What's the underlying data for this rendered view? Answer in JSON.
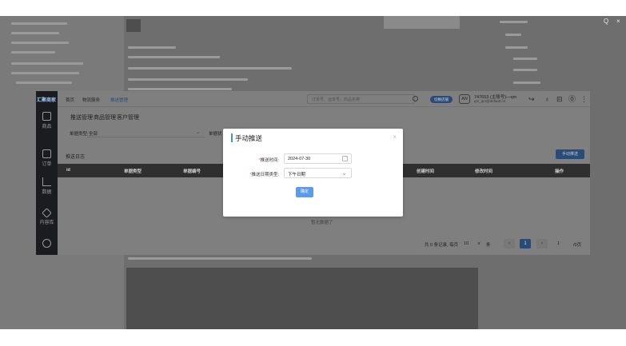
{
  "viewer": {
    "controls": [
      "Q",
      "×"
    ]
  },
  "app": {
    "logo": "汇聚商家",
    "sidebar": [
      {
        "label": "商品",
        "icon": "shopping-bag-icon"
      },
      {
        "label": "订单",
        "icon": "order-icon"
      },
      {
        "label": "数据",
        "icon": "chart-icon"
      },
      {
        "label": "内容库",
        "icon": "content-icon"
      },
      {
        "label": "",
        "icon": "gear-icon"
      }
    ],
    "breadcrumb": [
      "首页",
      "物流服务",
      "推送管理"
    ],
    "search_placeholder": "订单号、运单号、商品名称",
    "header_pill": "切换店铺",
    "avatar_text": "AW",
    "user_line1": "747653 (主账号)—qm",
    "user_line2": "qm_qm@default.cn",
    "tabs": [
      "推送管理",
      "商品管理",
      "客户管理"
    ],
    "filter_label": "单据类型:",
    "filter_value": "全部",
    "filter_label2": "单据状",
    "section_title": "推送日志",
    "push_button": "手动推送",
    "table_headers": [
      "id",
      "单据类型",
      "单据编号",
      "创建时间",
      "修改时间",
      "操作"
    ],
    "empty_text": "暂无数据了",
    "pagination": {
      "summary": "共 0 条记录, 每页",
      "page_size": "10",
      "page_size_unit": "条",
      "current_page": "1",
      "goto_value": "1",
      "total_pages": "/0页"
    }
  },
  "modal": {
    "title": "手动推送",
    "close": "×",
    "date_label": "推送时间:",
    "date_value": "2024-07-30",
    "range_label": "推送日期类型:",
    "range_value": "下午日期",
    "confirm_label": "确定",
    "required_mark": "*"
  },
  "colors": {
    "accent": "#5b9be8",
    "title_bar": "#4b8be8",
    "required": "#f56c6c"
  }
}
